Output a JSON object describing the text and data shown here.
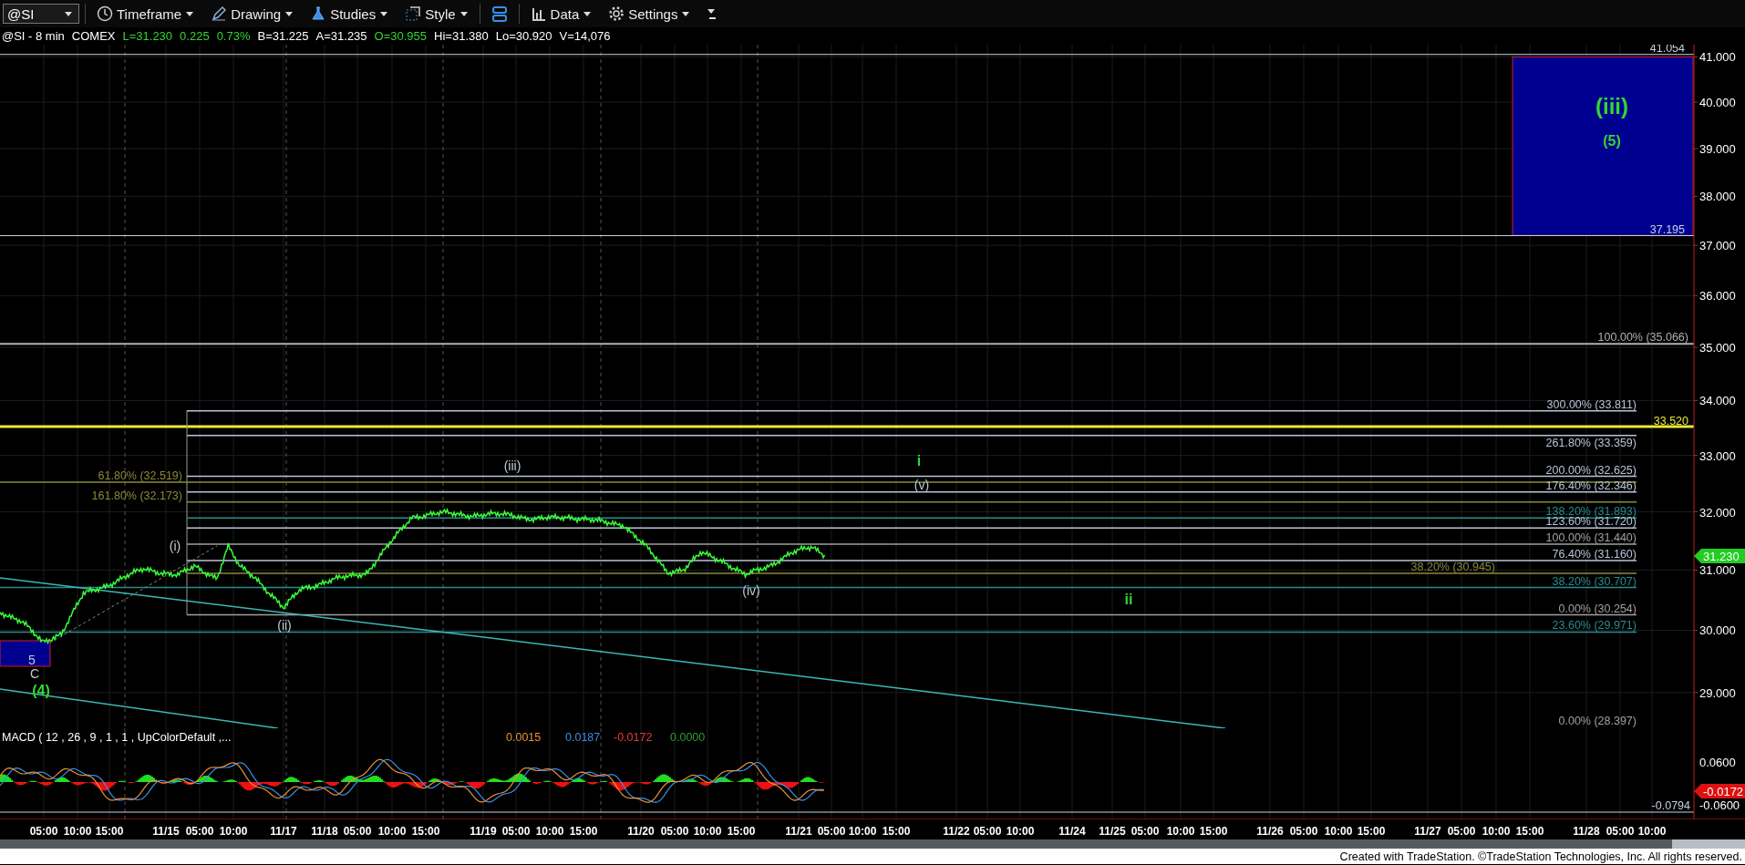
{
  "toolbar": {
    "symbol": "@SI",
    "buttons": [
      {
        "kind": "timeframe",
        "label": "Timeframe"
      },
      {
        "kind": "drawing",
        "label": "Drawing"
      },
      {
        "kind": "studies",
        "label": "Studies"
      },
      {
        "kind": "style",
        "label": "Style"
      },
      {
        "kind": "layout"
      },
      {
        "kind": "data",
        "label": "Data"
      },
      {
        "kind": "settings",
        "label": "Settings"
      }
    ]
  },
  "quote_line": [
    {
      "text": "@SI - 8 min",
      "color": "#ffffff"
    },
    {
      "text": "COMEX",
      "color": "#ffffff"
    },
    {
      "text": "L=31.230",
      "color": "#33d633"
    },
    {
      "text": "0.225",
      "color": "#33d633"
    },
    {
      "text": "0.73%",
      "color": "#33d633"
    },
    {
      "text": "B=31.225",
      "color": "#ffffff"
    },
    {
      "text": "A=31.235",
      "color": "#ffffff"
    },
    {
      "text": "O=30.955",
      "color": "#33d633"
    },
    {
      "text": "Hi=31.380",
      "color": "#ffffff"
    },
    {
      "text": "Lo=30.920",
      "color": "#ffffff"
    },
    {
      "text": "V=14,076",
      "color": "#ffffff"
    }
  ],
  "price_axis": [
    "41.000",
    "40.000",
    "39.000",
    "38.000",
    "37.000",
    "36.000",
    "35.000",
    "34.000",
    "33.000",
    "32.000",
    "31.000",
    "30.000",
    "29.000"
  ],
  "price_tag": "31.230",
  "horizontal_lines": [
    {
      "label": "41.054",
      "color": "#c8d0e0"
    },
    {
      "label": "37.195",
      "color": "#c8d0e0"
    },
    {
      "label": "100.00% (35.066)",
      "color": "#b0b0b0"
    },
    {
      "label": "33.520",
      "color": "#e8e83a"
    }
  ],
  "fib_levels": [
    {
      "label": "300.00% (33.811)",
      "color": "#b8c4d8"
    },
    {
      "label": "261.80% (33.359)",
      "color": "#b8c4d8"
    },
    {
      "label": "61.80% (32.519)",
      "color": "#8a8a3a"
    },
    {
      "label": "200.00% (32.625)",
      "color": "#b8c4d8"
    },
    {
      "label": "161.80% (32.173)",
      "color": "#8a8a3a"
    },
    {
      "label": "176.40% (32.346)",
      "color": "#b8c4d8"
    },
    {
      "label": "138.20% (31.893)",
      "color": "#2a8c8c"
    },
    {
      "label": "123.60% (31.720)",
      "color": "#b8c4d8"
    },
    {
      "label": "100.00% (31.440)",
      "color": "#a0a0a0"
    },
    {
      "label": "76.40% (31.160)",
      "color": "#b8c4d8"
    },
    {
      "label": "38.20% (30.945)",
      "color": "#8a8a3a"
    },
    {
      "label": "38.20% (30.707)",
      "color": "#2a8c8c"
    },
    {
      "label": "0.00% (30.254)",
      "color": "#a0a0a0"
    },
    {
      "label": "23.60% (29.971)",
      "color": "#2a8c8c"
    },
    {
      "label": "0.00% (28.397)",
      "color": "#a0a0a0"
    }
  ],
  "wave_labels": [
    {
      "text": "(iii)",
      "kind": "major",
      "color": "#33d633"
    },
    {
      "text": "(5)",
      "kind": "major",
      "color": "#33d633"
    },
    {
      "text": "i",
      "kind": "major",
      "color": "#33d633"
    },
    {
      "text": "(v)",
      "kind": "minor",
      "color": "#c0c8d8"
    },
    {
      "text": "(iii)",
      "kind": "minor",
      "color": "#c0c8d8"
    },
    {
      "text": "(i)",
      "kind": "minor",
      "color": "#c0c8d8"
    },
    {
      "text": "(ii)",
      "kind": "minor",
      "color": "#c0c8d8"
    },
    {
      "text": "(iv)",
      "kind": "minor",
      "color": "#c0c8d8"
    },
    {
      "text": "ii",
      "kind": "major",
      "color": "#33d633"
    },
    {
      "text": "5",
      "kind": "minor",
      "color": "#c0c8d8"
    },
    {
      "text": "C",
      "kind": "minor",
      "color": "#c0c8d8"
    },
    {
      "text": "(4)",
      "kind": "major",
      "color": "#33d633"
    }
  ],
  "macd": {
    "title": "MACD ( 12 , 26 , 9 , 1 , 1 , UpColorDefault ,...",
    "values": [
      {
        "text": "0.0015",
        "color": "#e8903a"
      },
      {
        "text": "0.0187",
        "color": "#3a8ee8"
      },
      {
        "text": "-0.0172",
        "color": "#e83a3a"
      },
      {
        "text": "0.0000",
        "color": "#2e9e2e"
      }
    ],
    "axis": [
      "0.0600",
      "-0.0600"
    ],
    "tag": "-0.0172",
    "low_label": "-0.0794"
  },
  "time_axis": [
    "05:00",
    "10:00",
    "15:00",
    "11/15",
    "05:00",
    "10:00",
    "11/17",
    "11/18",
    "05:00",
    "10:00",
    "15:00",
    "11/19",
    "05:00",
    "10:00",
    "15:00",
    "11/20",
    "05:00",
    "10:00",
    "15:00",
    "11/21",
    "05:00",
    "10:00",
    "15:00",
    "11/22",
    "05:00",
    "10:00",
    "11/24",
    "11/25",
    "05:00",
    "10:00",
    "15:00",
    "11/26",
    "05:00",
    "10:00",
    "15:00",
    "11/27",
    "05:00",
    "10:00",
    "15:00",
    "11/28",
    "05:00",
    "10:00"
  ],
  "footer": "Created with TradeStation. ©TradeStation Technologies, Inc. All rights reserved."
}
